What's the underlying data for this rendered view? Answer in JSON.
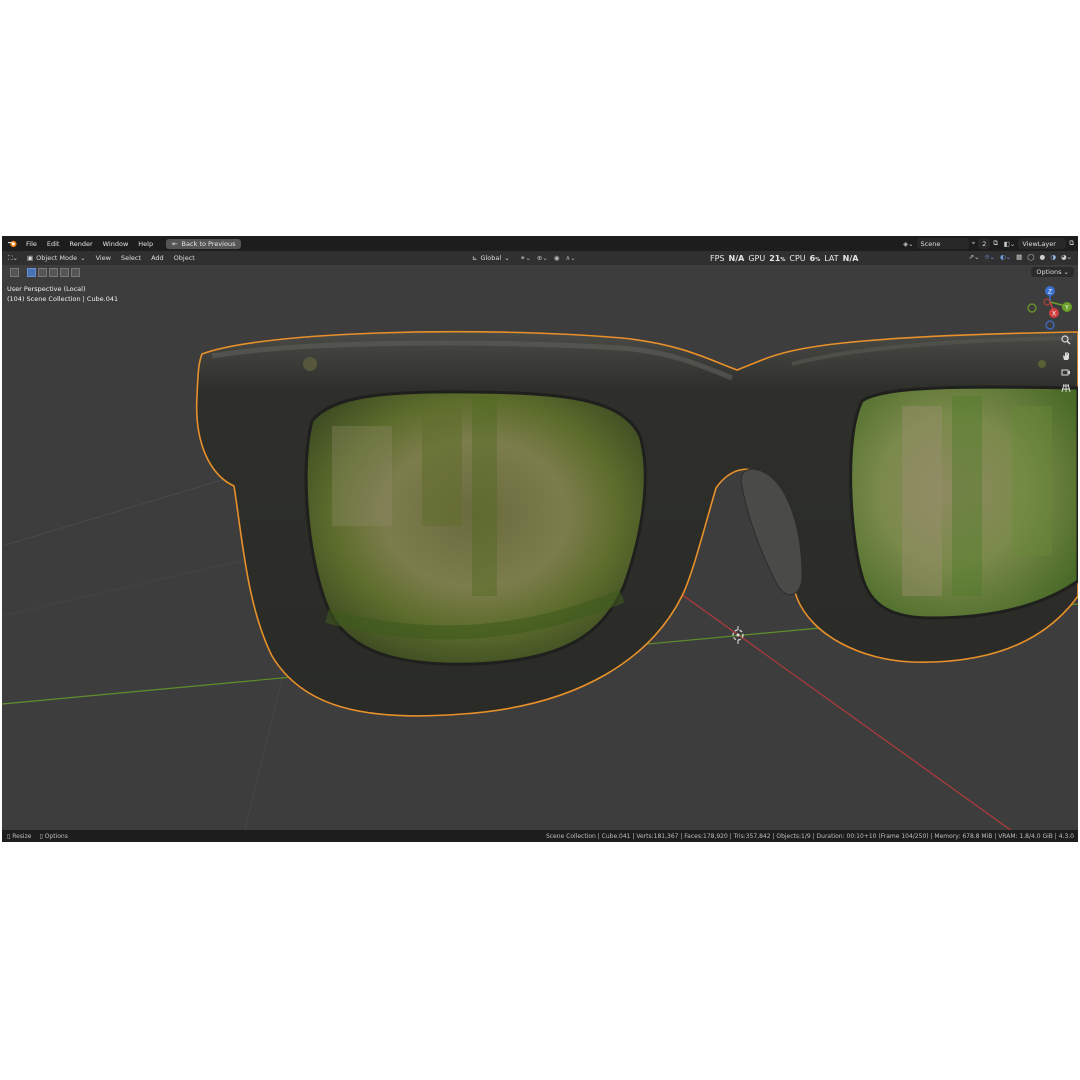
{
  "menu": {
    "file": "File",
    "edit": "Edit",
    "render": "Render",
    "window": "Window",
    "help": "Help",
    "back_to_previous": "Back to Previous"
  },
  "scene": {
    "name": "Scene",
    "count": "2"
  },
  "view_layer": "ViewLayer",
  "header": {
    "mode": "Object Mode",
    "view": "View",
    "select": "Select",
    "add": "Add",
    "object": "Object",
    "orientation": "Global",
    "options": "Options"
  },
  "perf": {
    "fps_label": "FPS",
    "fps_value": "N/A",
    "gpu_label": "GPU",
    "gpu_value": "21",
    "cpu_label": "CPU",
    "cpu_value": "6",
    "lat_label": "LAT",
    "lat_value": "N/A"
  },
  "viewport": {
    "perspective": "User Perspective (Local)",
    "collection_line": "(104) Scene Collection | Cube.041"
  },
  "gizmo": {
    "z": "Z",
    "y": "Y",
    "x": "X"
  },
  "status": {
    "resize": "Resize",
    "options": "Options",
    "stats": "Scene Collection | Cube.041 | Verts:181,367 | Faces:178,920 | Tris:357,842 | Objects:1/9 | Duration: 00:10+10 (Frame 104/250) | Memory: 678.8 MiB | VRAM: 1.8/4.0 GiB | 4.3.0"
  },
  "colors": {
    "background": "#3d3d3d",
    "selection_outline": "#e8902a",
    "x_axis": "#b23a3a",
    "y_axis": "#5f8f2a",
    "frame": "#2c2d29",
    "lens": "#8a8a58"
  },
  "icons": [
    "blender-logo-icon",
    "cursor-tool-icon",
    "hand-pan-icon",
    "camera-icon",
    "grid-icon",
    "zoom-icon"
  ]
}
